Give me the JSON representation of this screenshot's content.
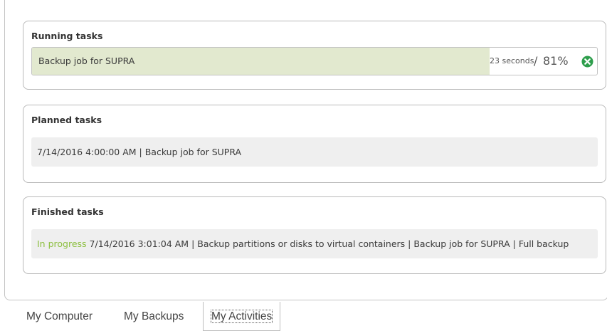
{
  "running": {
    "title": "Running tasks",
    "job_label": "Backup job for SUPRA",
    "time_remaining": "23 seconds",
    "separator": "/",
    "percent_label": "81%",
    "progress": 0.81,
    "cancel_icon": "cancel-circle-icon",
    "colors": {
      "progress_fill": "#e2e9cf",
      "cancel": "#2e9e4c"
    }
  },
  "planned": {
    "title": "Planned tasks",
    "items": [
      {
        "text": "7/14/2016 4:00:00 AM | Backup job for SUPRA"
      }
    ]
  },
  "finished": {
    "title": "Finished tasks",
    "items": [
      {
        "status": "In progress",
        "text": "7/14/2016 3:01:04 AM | Backup partitions or disks to virtual containers | Backup job for SUPRA | Full backup"
      }
    ],
    "colors": {
      "in_progress": "#8cbf3f"
    }
  },
  "tabs": [
    {
      "label": "My Computer",
      "active": false
    },
    {
      "label": "My Backups",
      "active": false
    },
    {
      "label": "My Activities",
      "active": true
    }
  ]
}
